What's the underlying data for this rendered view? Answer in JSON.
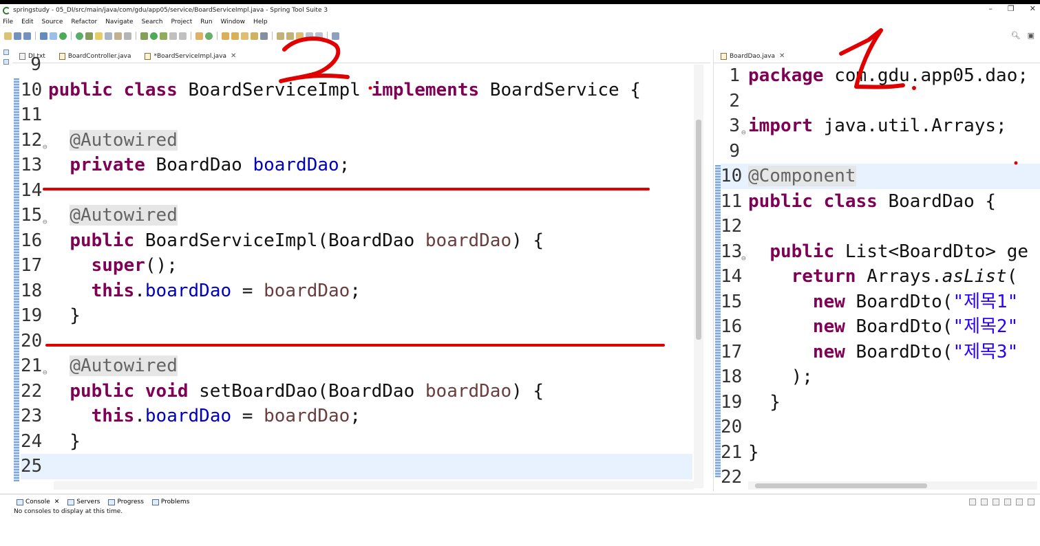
{
  "window": {
    "title": "springstudy - 05_DI/src/main/java/com/gdu/app05/service/BoardServiceImpl.java - Spring Tool Suite 3",
    "minimize": "–",
    "maximize": "❐",
    "close": "✕"
  },
  "menu": [
    "File",
    "Edit",
    "Source",
    "Refactor",
    "Navigate",
    "Search",
    "Project",
    "Run",
    "Window",
    "Help"
  ],
  "editor_left": {
    "tabs": [
      {
        "label": "DI.txt",
        "close": ""
      },
      {
        "label": "BoardController.java",
        "close": ""
      },
      {
        "label": "*BoardServiceImpl.java",
        "close": "✕"
      }
    ],
    "lines": [
      {
        "n": "9",
        "tokens": []
      },
      {
        "n": "10",
        "tokens": [
          {
            "t": "public class ",
            "c": "kw"
          },
          {
            "t": "BoardServiceImpl ",
            "c": ""
          },
          {
            "t": "implements ",
            "c": "kw"
          },
          {
            "t": "BoardService {",
            "c": ""
          }
        ]
      },
      {
        "n": "11",
        "tokens": []
      },
      {
        "n": "12",
        "fold": true,
        "tokens": [
          {
            "t": "  ",
            "c": ""
          },
          {
            "t": "@Autowired",
            "c": "ann"
          }
        ]
      },
      {
        "n": "13",
        "tokens": [
          {
            "t": "  ",
            "c": ""
          },
          {
            "t": "private ",
            "c": "kw"
          },
          {
            "t": "BoardDao ",
            "c": ""
          },
          {
            "t": "boardDao",
            "c": "fld"
          },
          {
            "t": ";",
            "c": ""
          }
        ]
      },
      {
        "n": "14",
        "tokens": []
      },
      {
        "n": "15",
        "fold": true,
        "tokens": [
          {
            "t": "  ",
            "c": ""
          },
          {
            "t": "@Autowired",
            "c": "ann"
          }
        ]
      },
      {
        "n": "16",
        "tokens": [
          {
            "t": "  ",
            "c": ""
          },
          {
            "t": "public ",
            "c": "kw"
          },
          {
            "t": "BoardServiceImpl(BoardDao ",
            "c": ""
          },
          {
            "t": "boardDao",
            "c": "par"
          },
          {
            "t": ") {",
            "c": ""
          }
        ]
      },
      {
        "n": "17",
        "tokens": [
          {
            "t": "    ",
            "c": ""
          },
          {
            "t": "super",
            "c": "kw"
          },
          {
            "t": "();",
            "c": ""
          }
        ]
      },
      {
        "n": "18",
        "tokens": [
          {
            "t": "    ",
            "c": ""
          },
          {
            "t": "this",
            "c": "kw"
          },
          {
            "t": ".",
            "c": ""
          },
          {
            "t": "boardDao",
            "c": "fld"
          },
          {
            "t": " = ",
            "c": ""
          },
          {
            "t": "boardDao",
            "c": "par"
          },
          {
            "t": ";",
            "c": ""
          }
        ]
      },
      {
        "n": "19",
        "tokens": [
          {
            "t": "  }",
            "c": ""
          }
        ]
      },
      {
        "n": "20",
        "tokens": []
      },
      {
        "n": "21",
        "fold": true,
        "tokens": [
          {
            "t": "  ",
            "c": ""
          },
          {
            "t": "@Autowired",
            "c": "ann"
          }
        ]
      },
      {
        "n": "22",
        "tokens": [
          {
            "t": "  ",
            "c": ""
          },
          {
            "t": "public void ",
            "c": "kw"
          },
          {
            "t": "setBoardDao(BoardDao ",
            "c": ""
          },
          {
            "t": "boardDao",
            "c": "par"
          },
          {
            "t": ") {",
            "c": ""
          }
        ]
      },
      {
        "n": "23",
        "tokens": [
          {
            "t": "    ",
            "c": ""
          },
          {
            "t": "this",
            "c": "kw"
          },
          {
            "t": ".",
            "c": ""
          },
          {
            "t": "boardDao",
            "c": "fld"
          },
          {
            "t": " = ",
            "c": ""
          },
          {
            "t": "boardDao",
            "c": "par"
          },
          {
            "t": ";",
            "c": ""
          }
        ]
      },
      {
        "n": "24",
        "tokens": [
          {
            "t": "  }",
            "c": ""
          }
        ]
      },
      {
        "n": "25",
        "tokens": []
      }
    ]
  },
  "editor_right": {
    "tabs": [
      {
        "label": "BoardDao.java",
        "close": "✕"
      }
    ],
    "lines": [
      {
        "n": "1",
        "tokens": [
          {
            "t": "package ",
            "c": "kw"
          },
          {
            "t": "com.gdu.app05.dao;",
            "c": ""
          }
        ]
      },
      {
        "n": "2",
        "tokens": []
      },
      {
        "n": "3",
        "fold": true,
        "tokens": [
          {
            "t": "import ",
            "c": "kw"
          },
          {
            "t": "java.util.Arrays;",
            "c": ""
          }
        ]
      },
      {
        "n": "9",
        "tokens": []
      },
      {
        "n": "10",
        "tokens": [
          {
            "t": "@Component",
            "c": "ann"
          }
        ]
      },
      {
        "n": "11",
        "tokens": [
          {
            "t": "public class ",
            "c": "kw"
          },
          {
            "t": "BoardDao {",
            "c": ""
          }
        ]
      },
      {
        "n": "12",
        "tokens": []
      },
      {
        "n": "13",
        "fold": true,
        "tokens": [
          {
            "t": "  ",
            "c": ""
          },
          {
            "t": "public ",
            "c": "kw"
          },
          {
            "t": "List<BoardDto> ge",
            "c": ""
          }
        ]
      },
      {
        "n": "14",
        "tokens": [
          {
            "t": "    ",
            "c": ""
          },
          {
            "t": "return ",
            "c": "kw"
          },
          {
            "t": "Arrays.",
            "c": ""
          },
          {
            "t": "asList",
            "c": "it"
          },
          {
            "t": "(",
            "c": ""
          }
        ]
      },
      {
        "n": "15",
        "tokens": [
          {
            "t": "      ",
            "c": ""
          },
          {
            "t": "new ",
            "c": "kw"
          },
          {
            "t": "BoardDto(",
            "c": ""
          },
          {
            "t": "\"제목1\"",
            "c": "str"
          }
        ]
      },
      {
        "n": "16",
        "tokens": [
          {
            "t": "      ",
            "c": ""
          },
          {
            "t": "new ",
            "c": "kw"
          },
          {
            "t": "BoardDto(",
            "c": ""
          },
          {
            "t": "\"제목2\"",
            "c": "str"
          }
        ]
      },
      {
        "n": "17",
        "tokens": [
          {
            "t": "      ",
            "c": ""
          },
          {
            "t": "new ",
            "c": "kw"
          },
          {
            "t": "BoardDto(",
            "c": ""
          },
          {
            "t": "\"제목3\"",
            "c": "str"
          }
        ]
      },
      {
        "n": "18",
        "tokens": [
          {
            "t": "    );",
            "c": ""
          }
        ]
      },
      {
        "n": "19",
        "tokens": [
          {
            "t": "  }",
            "c": ""
          }
        ]
      },
      {
        "n": "20",
        "tokens": []
      },
      {
        "n": "21",
        "tokens": [
          {
            "t": "}",
            "c": ""
          }
        ]
      },
      {
        "n": "22",
        "tokens": []
      }
    ]
  },
  "console": {
    "tabs": [
      {
        "label": "Console",
        "close": "✕"
      },
      {
        "label": "Servers"
      },
      {
        "label": "Progress"
      },
      {
        "label": "Problems"
      }
    ],
    "message": "No consoles to display at this time."
  },
  "annotations": {
    "mark_left": "2",
    "mark_right": "1",
    "ink_color": "#e10000"
  }
}
